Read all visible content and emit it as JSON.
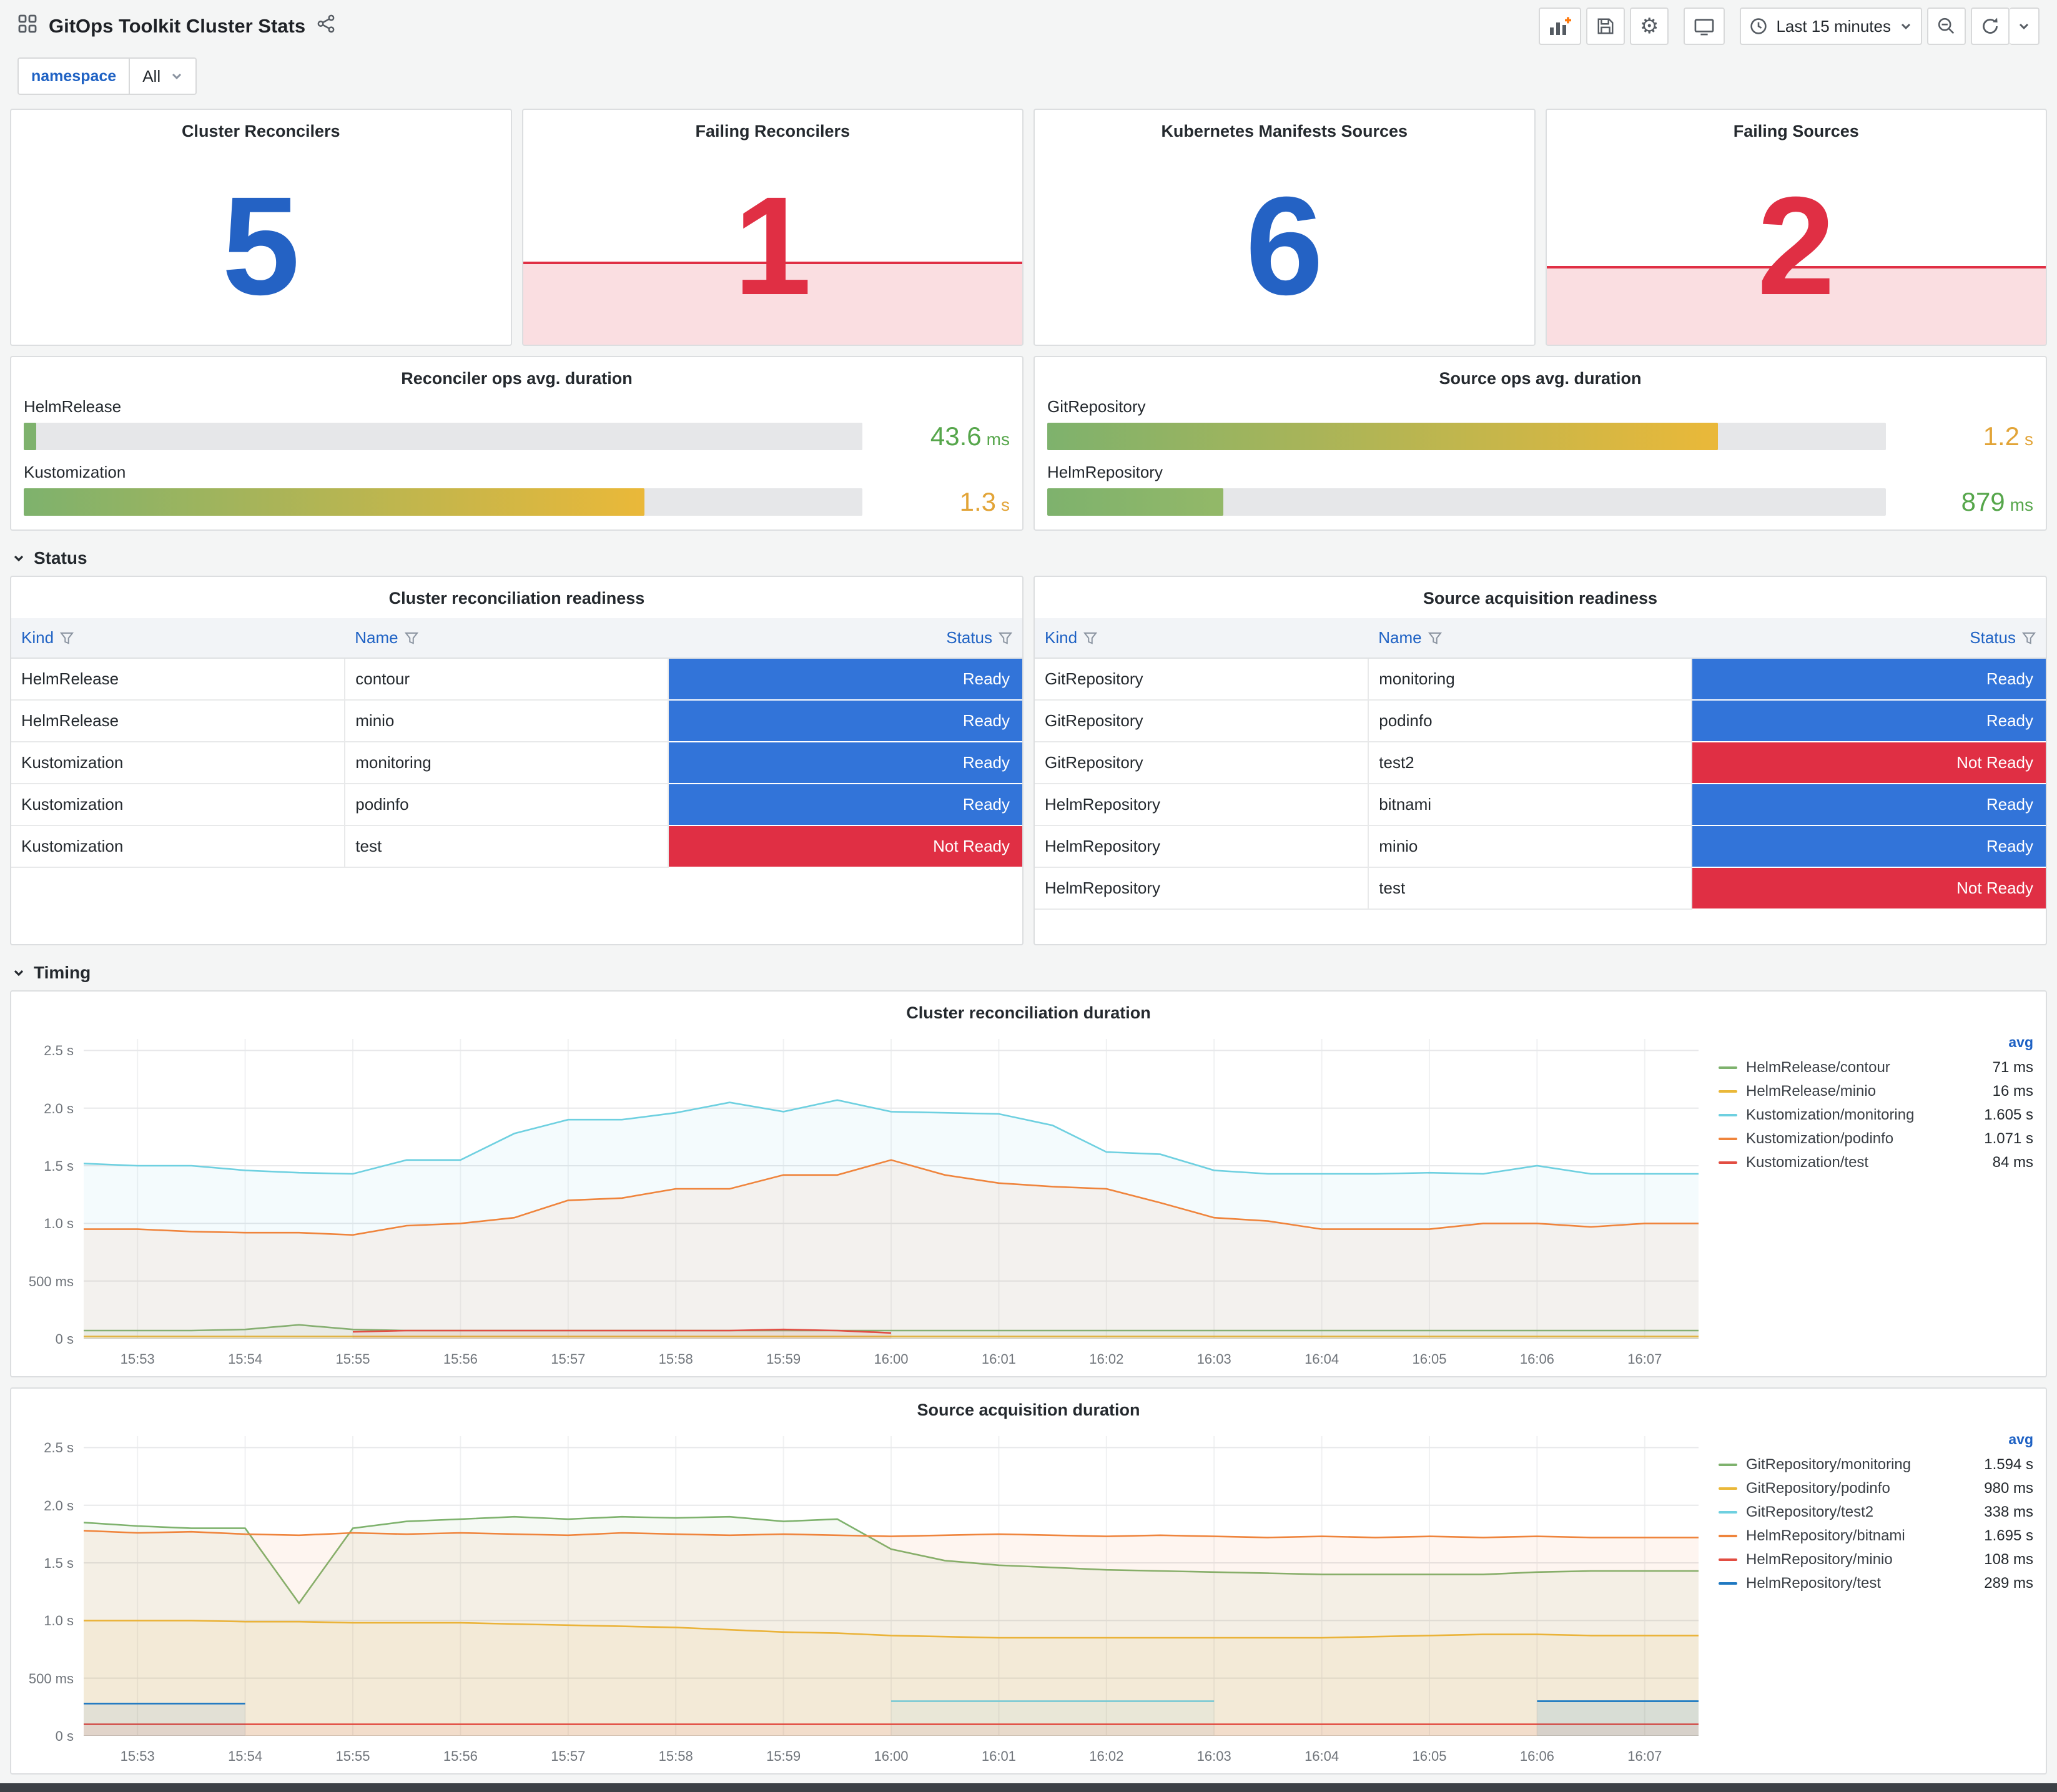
{
  "theme": {
    "page_bg": "#f4f5f5",
    "panel_bg": "#ffffff",
    "link_blue": "#1f62c4",
    "ready_bg": "#3274d9",
    "not_ready_bg": "#e02f44"
  },
  "icons": {
    "settings": "⚙"
  },
  "header": {
    "title": "GitOps Toolkit Cluster Stats",
    "time_picker_label": "Last 15 minutes"
  },
  "variables": {
    "label": "namespace",
    "value": "All"
  },
  "stat_panels": [
    {
      "title": "Cluster Reconcilers",
      "value": "5",
      "color": "#2462c4"
    },
    {
      "title": "Failing Reconcilers",
      "value": "1",
      "color": "#e02f44",
      "fill_height_pct": 42,
      "fill_bg": "rgba(224,47,68,0.16)",
      "fill_line": "#e02f44"
    },
    {
      "title": "Kubernetes Manifests Sources",
      "value": "6",
      "color": "#2462c4"
    },
    {
      "title": "Failing Sources",
      "value": "2",
      "color": "#e02f44",
      "fill_height_pct": 40,
      "fill_bg": "rgba(224,47,68,0.16)",
      "fill_line": "#e02f44"
    }
  ],
  "gauge_panels": [
    {
      "title": "Reconciler ops avg. duration",
      "bars": [
        {
          "label": "HelmRelease",
          "value": "43.6",
          "unit": "ms",
          "percent": 1.5,
          "fill_from": "#7eb26d",
          "fill_to": "#7eb26d",
          "value_color": "#56a64b"
        },
        {
          "label": "Kustomization",
          "value": "1.3",
          "unit": "s",
          "percent": 74,
          "fill_from": "#7eb26d",
          "fill_to": "#eab839",
          "value_color": "#e2a437"
        }
      ]
    },
    {
      "title": "Source ops avg. duration",
      "bars": [
        {
          "label": "GitRepository",
          "value": "1.2",
          "unit": "s",
          "percent": 80,
          "fill_from": "#7eb26d",
          "fill_to": "#eab839",
          "value_color": "#e2a437"
        },
        {
          "label": "HelmRepository",
          "value": "879",
          "unit": "ms",
          "percent": 21,
          "fill_from": "#7eb26d",
          "fill_to": "#93b868",
          "value_color": "#56a64b"
        }
      ]
    }
  ],
  "sections": {
    "status": "Status",
    "timing": "Timing"
  },
  "table_panels": [
    {
      "title": "Cluster reconciliation readiness",
      "columns": [
        "Kind",
        "Name",
        "Status"
      ],
      "rows": [
        [
          "HelmRelease",
          "contour",
          "Ready"
        ],
        [
          "HelmRelease",
          "minio",
          "Ready"
        ],
        [
          "Kustomization",
          "monitoring",
          "Ready"
        ],
        [
          "Kustomization",
          "podinfo",
          "Ready"
        ],
        [
          "Kustomization",
          "test",
          "Not Ready"
        ]
      ]
    },
    {
      "title": "Source acquisition readiness",
      "columns": [
        "Kind",
        "Name",
        "Status"
      ],
      "rows": [
        [
          "GitRepository",
          "monitoring",
          "Ready"
        ],
        [
          "GitRepository",
          "podinfo",
          "Ready"
        ],
        [
          "GitRepository",
          "test2",
          "Not Ready"
        ],
        [
          "HelmRepository",
          "bitnami",
          "Ready"
        ],
        [
          "HelmRepository",
          "minio",
          "Ready"
        ],
        [
          "HelmRepository",
          "test",
          "Not Ready"
        ]
      ]
    }
  ],
  "chart_data": [
    {
      "type": "line",
      "title": "Cluster reconciliation duration",
      "ylim": [
        0,
        2.6
      ],
      "legend_header": "avg",
      "grid": true,
      "legend_position": "right",
      "yticks": [
        {
          "v": 0,
          "label": "0 s"
        },
        {
          "v": 0.5,
          "label": "500 ms"
        },
        {
          "v": 1,
          "label": "1.0 s"
        },
        {
          "v": 1.5,
          "label": "1.5 s"
        },
        {
          "v": 2,
          "label": "2.0 s"
        },
        {
          "v": 2.5,
          "label": "2.5 s"
        }
      ],
      "xticks": [
        {
          "i": 1,
          "label": "15:53"
        },
        {
          "i": 3,
          "label": "15:54"
        },
        {
          "i": 5,
          "label": "15:55"
        },
        {
          "i": 7,
          "label": "15:56"
        },
        {
          "i": 9,
          "label": "15:57"
        },
        {
          "i": 11,
          "label": "15:58"
        },
        {
          "i": 13,
          "label": "15:59"
        },
        {
          "i": 15,
          "label": "16:00"
        },
        {
          "i": 17,
          "label": "16:01"
        },
        {
          "i": 19,
          "label": "16:02"
        },
        {
          "i": 21,
          "label": "16:03"
        },
        {
          "i": 23,
          "label": "16:04"
        },
        {
          "i": 25,
          "label": "16:05"
        },
        {
          "i": 27,
          "label": "16:06"
        },
        {
          "i": 29,
          "label": "16:07"
        }
      ],
      "series": [
        {
          "name": "HelmRelease/contour",
          "color": "#7EB26D",
          "avg": "71 ms",
          "values": [
            0.07,
            0.07,
            0.07,
            0.08,
            0.12,
            0.08,
            0.07,
            0.07,
            0.07,
            0.07,
            0.07,
            0.07,
            0.07,
            0.07,
            0.07,
            0.07,
            0.07,
            0.07,
            0.07,
            0.07,
            0.07,
            0.07,
            0.07,
            0.07,
            0.07,
            0.07,
            0.07,
            0.07,
            0.07,
            0.07,
            0.07
          ]
        },
        {
          "name": "HelmRelease/minio",
          "color": "#EAB839",
          "avg": "16 ms",
          "values": [
            0.02,
            0.02,
            0.02,
            0.02,
            0.02,
            0.02,
            0.02,
            0.02,
            0.02,
            0.02,
            0.02,
            0.02,
            0.02,
            0.02,
            0.02,
            0.02,
            0.02,
            0.02,
            0.02,
            0.02,
            0.02,
            0.02,
            0.02,
            0.02,
            0.02,
            0.02,
            0.02,
            0.02,
            0.02,
            0.02,
            0.02
          ]
        },
        {
          "name": "Kustomization/monitoring",
          "color": "#6ED0E0",
          "avg": "1.605 s",
          "values": [
            1.52,
            1.5,
            1.5,
            1.46,
            1.44,
            1.43,
            1.55,
            1.55,
            1.78,
            1.9,
            1.9,
            1.96,
            2.05,
            1.97,
            2.07,
            1.97,
            1.96,
            1.95,
            1.85,
            1.62,
            1.6,
            1.46,
            1.43,
            1.43,
            1.43,
            1.44,
            1.43,
            1.5,
            1.43,
            1.43,
            1.43
          ]
        },
        {
          "name": "Kustomization/podinfo",
          "color": "#EF843C",
          "avg": "1.071 s",
          "values": [
            0.95,
            0.95,
            0.93,
            0.92,
            0.92,
            0.9,
            0.98,
            1.0,
            1.05,
            1.2,
            1.22,
            1.3,
            1.3,
            1.42,
            1.42,
            1.55,
            1.42,
            1.35,
            1.32,
            1.3,
            1.18,
            1.05,
            1.02,
            0.95,
            0.95,
            0.95,
            1.0,
            1.0,
            0.97,
            1.0,
            1.0
          ]
        },
        {
          "name": "Kustomization/test",
          "color": "#E24D42",
          "avg": "84 ms",
          "values": [
            null,
            null,
            null,
            null,
            null,
            0.06,
            0.07,
            0.07,
            0.07,
            0.07,
            0.07,
            0.07,
            0.07,
            0.08,
            0.07,
            0.05,
            null,
            null,
            null,
            null,
            null,
            null,
            null,
            null,
            null,
            null,
            null,
            null,
            null,
            null,
            null
          ]
        }
      ]
    },
    {
      "type": "line",
      "title": "Source acquisition duration",
      "ylim": [
        0,
        2.6
      ],
      "legend_header": "avg",
      "grid": true,
      "legend_position": "right",
      "yticks": [
        {
          "v": 0,
          "label": "0 s"
        },
        {
          "v": 0.5,
          "label": "500 ms"
        },
        {
          "v": 1,
          "label": "1.0 s"
        },
        {
          "v": 1.5,
          "label": "1.5 s"
        },
        {
          "v": 2,
          "label": "2.0 s"
        },
        {
          "v": 2.5,
          "label": "2.5 s"
        }
      ],
      "xticks": [
        {
          "i": 1,
          "label": "15:53"
        },
        {
          "i": 3,
          "label": "15:54"
        },
        {
          "i": 5,
          "label": "15:55"
        },
        {
          "i": 7,
          "label": "15:56"
        },
        {
          "i": 9,
          "label": "15:57"
        },
        {
          "i": 11,
          "label": "15:58"
        },
        {
          "i": 13,
          "label": "15:59"
        },
        {
          "i": 15,
          "label": "16:00"
        },
        {
          "i": 17,
          "label": "16:01"
        },
        {
          "i": 19,
          "label": "16:02"
        },
        {
          "i": 21,
          "label": "16:03"
        },
        {
          "i": 23,
          "label": "16:04"
        },
        {
          "i": 25,
          "label": "16:05"
        },
        {
          "i": 27,
          "label": "16:06"
        },
        {
          "i": 29,
          "label": "16:07"
        }
      ],
      "series": [
        {
          "name": "GitRepository/monitoring",
          "color": "#7EB26D",
          "avg": "1.594 s",
          "values": [
            1.85,
            1.82,
            1.8,
            1.8,
            1.15,
            1.8,
            1.86,
            1.88,
            1.9,
            1.88,
            1.9,
            1.89,
            1.9,
            1.86,
            1.88,
            1.62,
            1.52,
            1.48,
            1.46,
            1.44,
            1.43,
            1.42,
            1.41,
            1.4,
            1.4,
            1.4,
            1.4,
            1.42,
            1.43,
            1.43,
            1.43
          ]
        },
        {
          "name": "GitRepository/podinfo",
          "color": "#EAB839",
          "avg": "980 ms",
          "values": [
            1.0,
            1.0,
            1.0,
            0.99,
            0.99,
            0.98,
            0.98,
            0.98,
            0.97,
            0.96,
            0.95,
            0.94,
            0.92,
            0.9,
            0.89,
            0.87,
            0.86,
            0.85,
            0.85,
            0.85,
            0.85,
            0.85,
            0.85,
            0.85,
            0.86,
            0.87,
            0.88,
            0.88,
            0.87,
            0.87,
            0.87
          ]
        },
        {
          "name": "GitRepository/test2",
          "color": "#6ED0E0",
          "avg": "338 ms",
          "values": [
            null,
            null,
            null,
            null,
            null,
            null,
            null,
            null,
            null,
            null,
            null,
            null,
            null,
            null,
            null,
            0.3,
            0.3,
            0.3,
            0.3,
            0.3,
            0.3,
            0.3,
            null,
            null,
            null,
            null,
            null,
            0.3,
            0.3,
            0.3,
            0.3
          ]
        },
        {
          "name": "HelmRepository/bitnami",
          "color": "#EF843C",
          "avg": "1.695 s",
          "values": [
            1.78,
            1.76,
            1.77,
            1.75,
            1.74,
            1.76,
            1.75,
            1.76,
            1.75,
            1.74,
            1.76,
            1.75,
            1.74,
            1.75,
            1.74,
            1.73,
            1.74,
            1.75,
            1.74,
            1.73,
            1.74,
            1.73,
            1.72,
            1.73,
            1.72,
            1.73,
            1.72,
            1.73,
            1.72,
            1.72,
            1.72
          ]
        },
        {
          "name": "HelmRepository/minio",
          "color": "#E24D42",
          "avg": "108 ms",
          "values": [
            0.1,
            0.1,
            0.1,
            0.1,
            0.1,
            0.1,
            0.1,
            0.1,
            0.1,
            0.1,
            0.1,
            0.1,
            0.1,
            0.1,
            0.1,
            0.1,
            0.1,
            0.1,
            0.1,
            0.1,
            0.1,
            0.1,
            0.1,
            0.1,
            0.1,
            0.1,
            0.1,
            0.1,
            0.1,
            0.1,
            0.1
          ]
        },
        {
          "name": "HelmRepository/test",
          "color": "#1F78C1",
          "avg": "289 ms",
          "values": [
            0.28,
            0.28,
            0.28,
            0.28,
            null,
            null,
            null,
            null,
            null,
            null,
            null,
            null,
            null,
            null,
            null,
            null,
            null,
            null,
            null,
            null,
            null,
            null,
            null,
            null,
            null,
            null,
            null,
            0.3,
            0.3,
            0.3,
            0.3
          ]
        }
      ]
    }
  ]
}
